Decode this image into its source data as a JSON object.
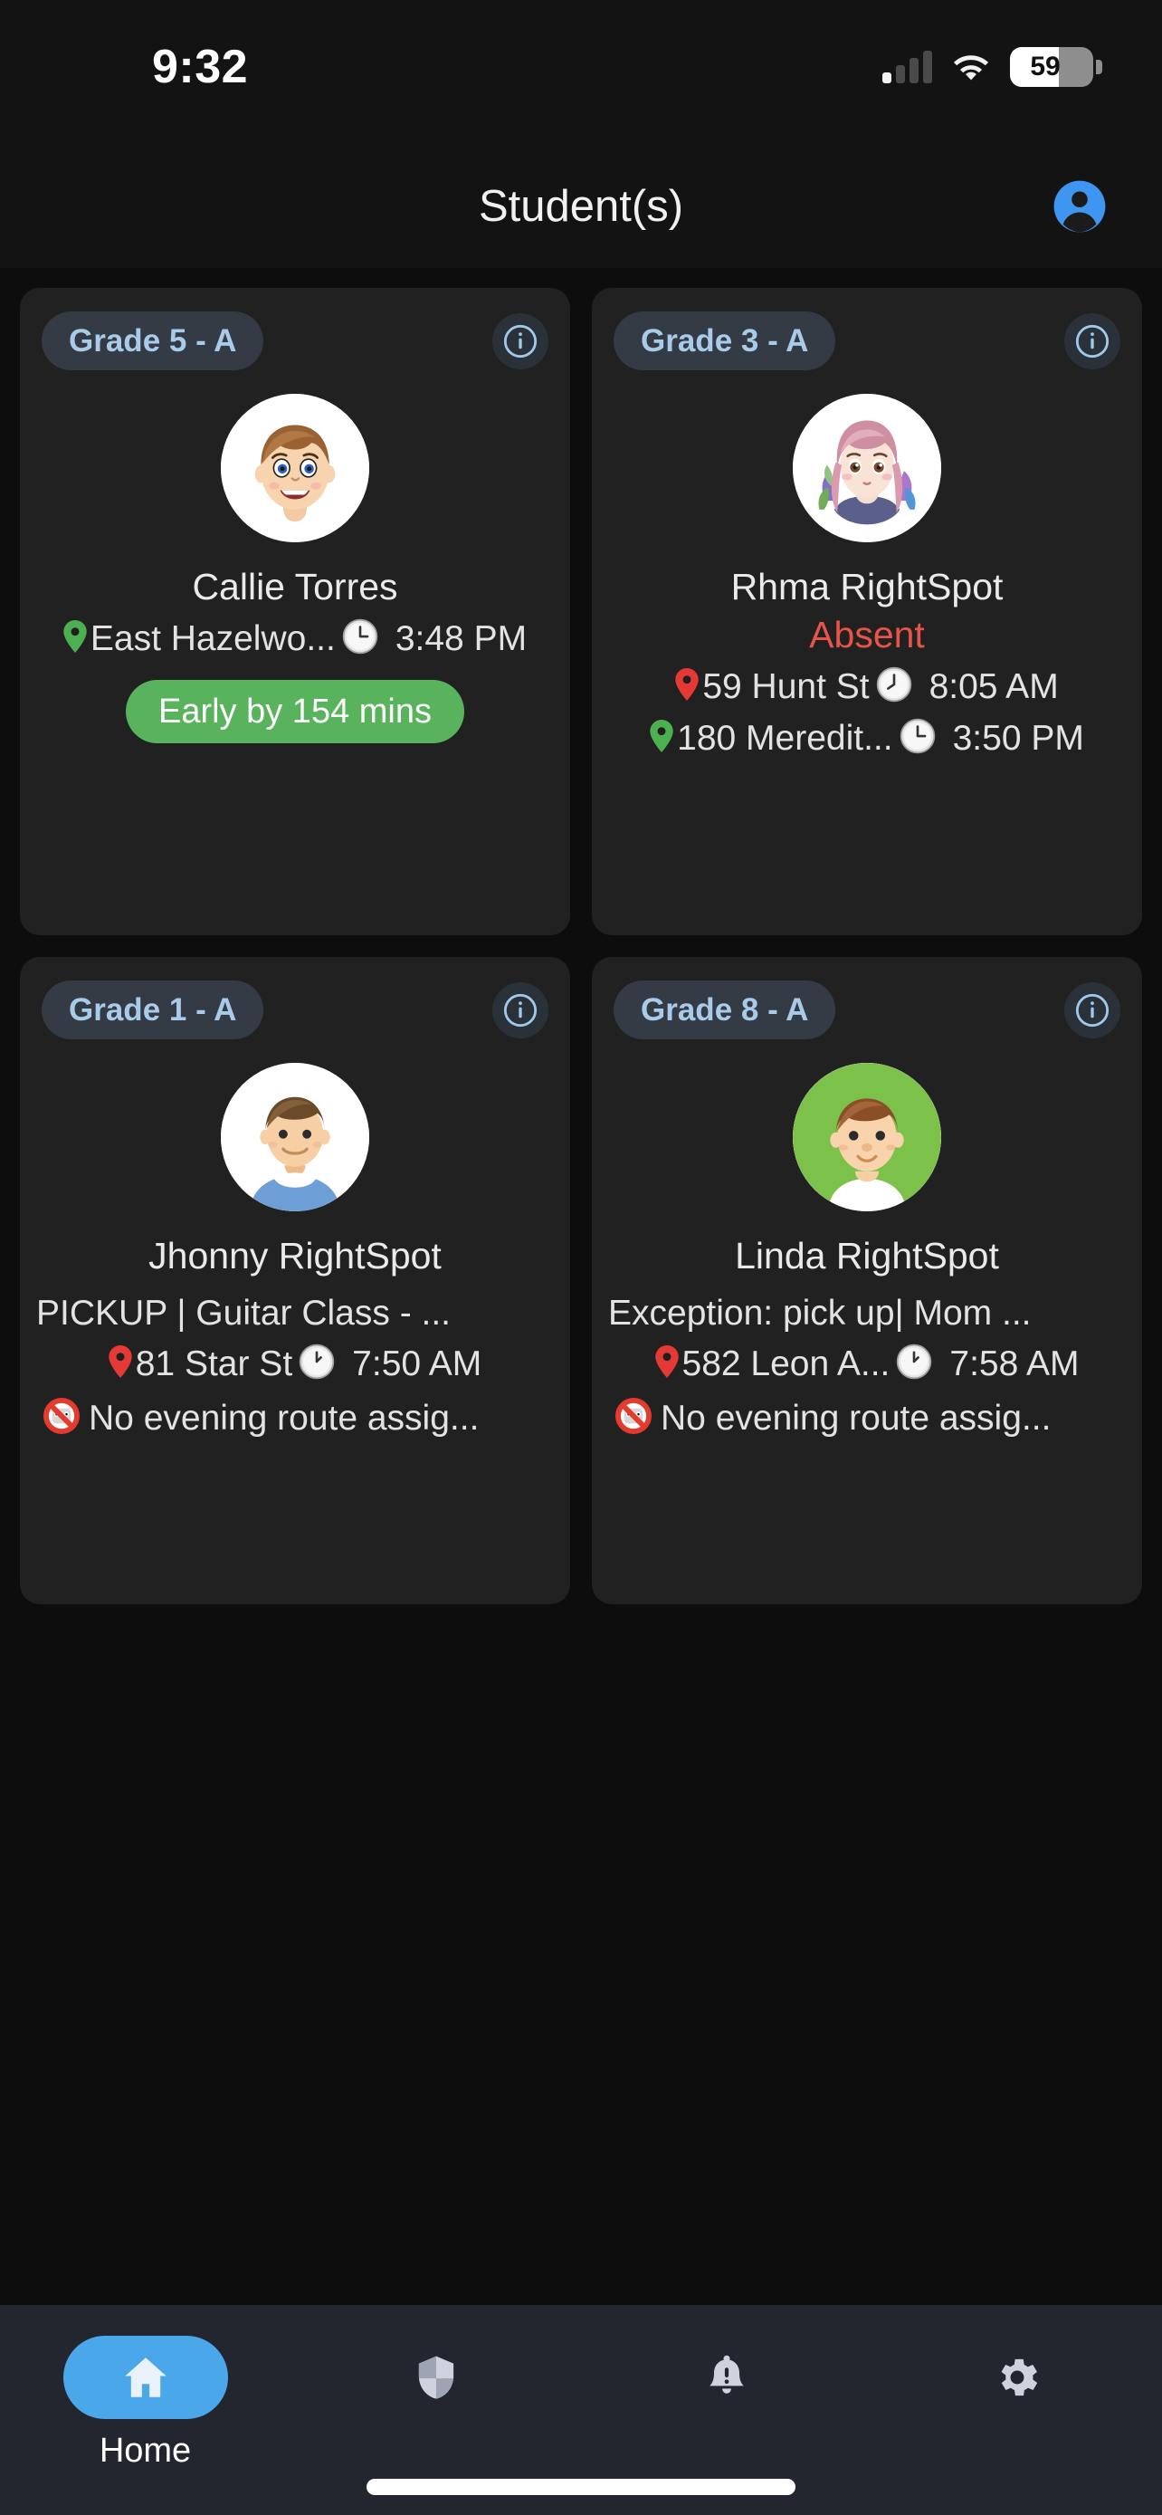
{
  "status_bar": {
    "time": "9:32",
    "signal_icon": "cellular-bars-icon",
    "wifi_icon": "wifi-icon",
    "battery_icon": "battery-icon",
    "battery_percent": "59"
  },
  "header": {
    "title": "Student(s)",
    "profile_icon": "account-circle-icon"
  },
  "students": [
    {
      "grade": "Grade 5 - A",
      "info_icon": "info-circle-icon",
      "avatar_icon": "student-boy-brownhair-avatar",
      "name": "Callie Torres",
      "status": "",
      "rows": [
        {
          "pin_icon": "location-pin-green-icon",
          "pin_color": "#4caf50",
          "place": "East Hazelwo...",
          "clock_icon": "clock-3-oclock-icon",
          "time": "3:48 PM"
        }
      ],
      "badge": {
        "label": "Early by 154 mins",
        "color": "#58b35c"
      }
    },
    {
      "grade": "Grade 3 - A",
      "info_icon": "info-circle-icon",
      "avatar_icon": "student-girl-pinkhair-avatar",
      "name": "Rhma RightSpot",
      "status": "Absent",
      "rows": [
        {
          "pin_icon": "location-pin-red-icon",
          "pin_color": "#e53935",
          "place": "59 Hunt St",
          "clock_icon": "clock-8-oclock-icon",
          "time": "8:05 AM"
        },
        {
          "pin_icon": "location-pin-green-icon",
          "pin_color": "#4caf50",
          "place": "180 Meredit...",
          "clock_icon": "clock-3-oclock-icon",
          "time": "3:50 PM"
        }
      ],
      "badge": null
    },
    {
      "grade": "Grade 1 - A",
      "info_icon": "info-circle-icon",
      "avatar_icon": "student-boy-blueshirt-avatar",
      "name": "Jhonny RightSpot",
      "exception": "PICKUP |  Guitar Class -  ...",
      "rows": [
        {
          "pin_icon": "location-pin-red-icon",
          "pin_color": "#e53935",
          "place": "81 Star St",
          "clock_icon": "clock-1-oclock-icon",
          "time": "7:50 AM"
        }
      ],
      "note": {
        "icon": "no-bus-prohibited-icon",
        "text": "No evening route assig..."
      },
      "badge": null
    },
    {
      "grade": "Grade 8 - A",
      "info_icon": "info-circle-icon",
      "avatar_icon": "student-boy-greenbg-avatar",
      "name": "Linda RightSpot",
      "exception": "Exception: pick up| Mom ...",
      "rows": [
        {
          "pin_icon": "location-pin-red-icon",
          "pin_color": "#e53935",
          "place": "582 Leon A...",
          "clock_icon": "clock-1-oclock-icon",
          "time": "7:58 AM"
        }
      ],
      "note": {
        "icon": "no-bus-prohibited-icon",
        "text": "No evening route assig..."
      },
      "badge": null
    }
  ],
  "tabbar": {
    "items": [
      {
        "icon": "home-icon",
        "label": "Home",
        "active": true
      },
      {
        "icon": "shield-icon",
        "label": "",
        "active": false
      },
      {
        "icon": "bell-alert-icon",
        "label": "",
        "active": false
      },
      {
        "icon": "gear-icon",
        "label": "",
        "active": false
      }
    ],
    "active_color": "#4aa8ea"
  }
}
